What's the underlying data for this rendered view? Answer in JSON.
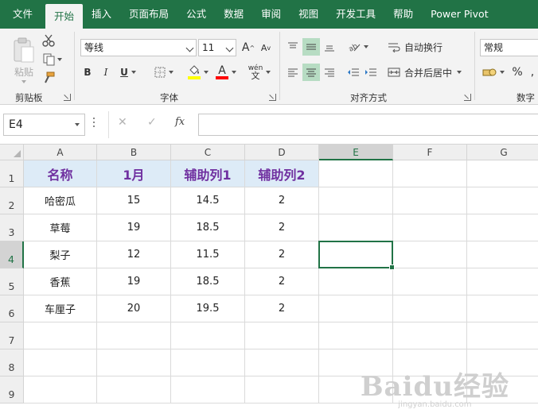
{
  "tabs": [
    "文件",
    "开始",
    "插入",
    "页面布局",
    "公式",
    "数据",
    "审阅",
    "视图",
    "开发工具",
    "帮助",
    "Power Pivot"
  ],
  "active_tab": 1,
  "ribbon": {
    "clipboard": {
      "paste_label": "粘贴",
      "group_label": "剪贴板"
    },
    "font": {
      "name": "等线",
      "size": "11",
      "grow": "A",
      "shrink": "A",
      "bold": "B",
      "italic": "I",
      "underline": "U",
      "font_color": "A",
      "phonetic": "wén",
      "group_label": "字体"
    },
    "alignment": {
      "wrap_text": "自动换行",
      "merge_center": "合并后居中",
      "group_label": "对齐方式"
    },
    "number": {
      "format": "常规",
      "percent": "%",
      "group_label": "数字"
    },
    "colors": {
      "accent": "#217346",
      "highlight": "#ffff00",
      "font_red": "#ff0000"
    }
  },
  "formula_bar": {
    "name_box": "E4",
    "fx": "fx",
    "cancel": "✕",
    "enter": "✓",
    "content": ""
  },
  "grid": {
    "columns": [
      "A",
      "B",
      "C",
      "D",
      "E",
      "F",
      "G"
    ],
    "rows": [
      "1",
      "2",
      "3",
      "4",
      "5",
      "6",
      "7",
      "8",
      "9"
    ],
    "selected_cell": "E4",
    "header_fill": "#ddebf7",
    "header_text_color": "#7030a0",
    "cells": [
      [
        "名称",
        "1月",
        "辅助列1",
        "辅助列2"
      ],
      [
        "哈密瓜",
        "15",
        "14.5",
        "2"
      ],
      [
        "草莓",
        "19",
        "18.5",
        "2"
      ],
      [
        "梨子",
        "12",
        "11.5",
        "2"
      ],
      [
        "香蕉",
        "19",
        "18.5",
        "2"
      ],
      [
        "车厘子",
        "20",
        "19.5",
        "2"
      ]
    ]
  },
  "watermark": {
    "brand": "Bai",
    "site": "jingyan.baidu.com"
  }
}
